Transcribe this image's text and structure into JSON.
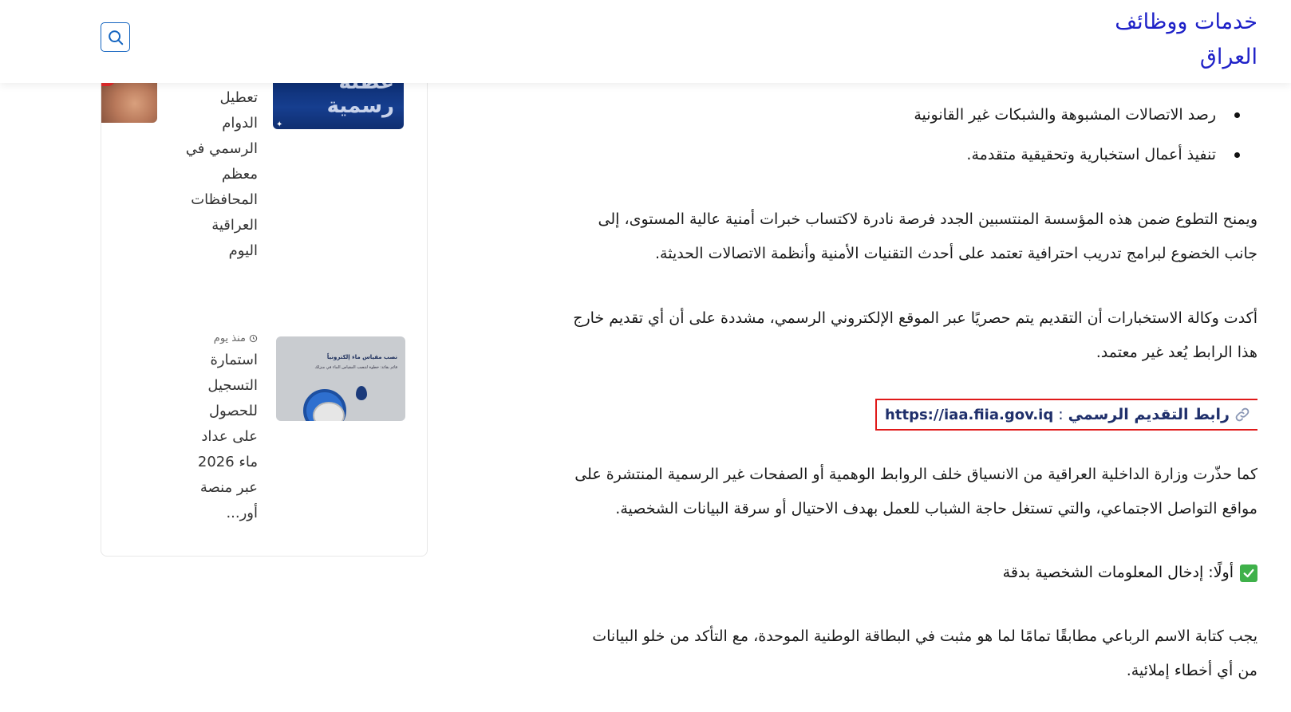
{
  "header": {
    "site_title_line1": "خدمات ووظائف",
    "site_title_line2": "العراق",
    "search_label": "بحث"
  },
  "article": {
    "bullets": [
      "رصد الاتصالات المشبوهة والشبكات غير القانونية",
      "تنفيذ أعمال استخبارية وتحقيقية متقدمة."
    ],
    "paragraph1_line1": "ويمنح التطوع ضمن هذه المؤسسة المنتسبين الجدد فرصة نادرة لاكتساب خبرات أمنية عالية المستوى، إلى",
    "paragraph1_line2": "جانب الخضوع لبرامج تدريب احترافية تعتمد على أحدث التقنيات الأمنية وأنظمة الاتصالات الحديثة.",
    "paragraph2_line1": "أكدت وكالة الاستخبارات أن التقديم يتم حصريًا عبر الموقع الإلكتروني الرسمي، مشددة على أن أي تقديم خارج",
    "paragraph2_line2": "هذا الرابط يُعد غير معتمد.",
    "link_label": "رابط التقديم الرسمي",
    "link_colon": ":",
    "link_url": "https://iaa.fiia.gov.iq",
    "paragraph3_line1": "كما حذّرت وزارة الداخلية العراقية من الانسياق خلف الروابط الوهمية أو الصفحات غير الرسمية المنتشرة على",
    "paragraph3_line2": "مواقع التواصل الاجتماعي، والتي تستغل حاجة الشباب للعمل بهدف الاحتيال أو سرقة البيانات الشخصية.",
    "check_heading": "أولًا: إدخال المعلومات الشخصية بدقة",
    "paragraph4_line1": "يجب كتابة الاسم الرباعي مطابقًا تمامًا لما هو مثبت في البطاقة الوطنية الموحدة، مع التأكد من خلو البيانات",
    "paragraph4_line2": "من أي أخطاء إملائية."
  },
  "sidebar": {
    "post1": {
      "lines": [
        "تعطيل",
        "الدوام",
        "الرسمي في",
        "معظم",
        "المحافظات",
        "العراقية",
        "اليوم"
      ],
      "thumb_text": "عطلة رسمية"
    },
    "post2": {
      "meta": "منذ يوم",
      "lines": [
        "استمارة",
        "التسجيل",
        "للحصول",
        "على عداد",
        "ماء 2026",
        "عبر منصة",
        "أور..."
      ],
      "thumb_title": "نصب مقياس ماء إلكترونياً",
      "thumb_sub": "قائم بقائد: خطوة لتنصب المقياس الماء في منزلك"
    }
  },
  "colors": {
    "title_blue": "#1f22c8",
    "link_navy": "#1f2f6b",
    "highlight_red": "#e01919",
    "check_green": "#3fb14a"
  }
}
